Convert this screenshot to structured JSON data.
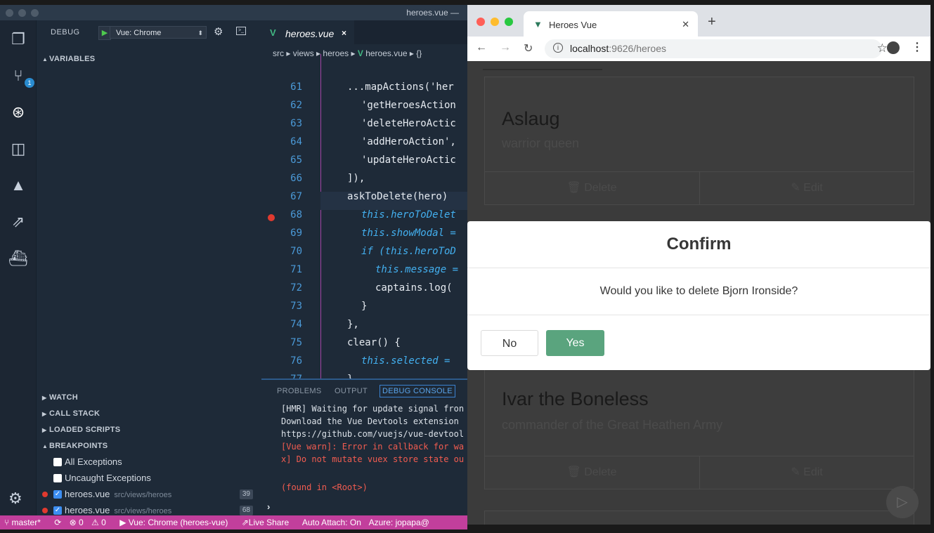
{
  "vscode": {
    "window_title": "heroes.vue —",
    "debug": {
      "label": "DEBUG",
      "config": "Vue: Chrome",
      "sections": {
        "variables": "VARIABLES",
        "watch": "WATCH",
        "call_stack": "CALL STACK",
        "loaded_scripts": "LOADED SCRIPTS",
        "breakpoints": "BREAKPOINTS"
      },
      "exceptions": [
        "All Exceptions",
        "Uncaught Exceptions"
      ],
      "breakpoints": [
        {
          "file": "heroes.vue",
          "path": "src/views/heroes",
          "line": "39"
        },
        {
          "file": "heroes.vue",
          "path": "src/views/heroes",
          "line": "68"
        }
      ]
    },
    "source_control_badge": "1",
    "editor": {
      "tab": "heroes.vue",
      "breadcrumb": [
        "src",
        "views",
        "heroes",
        "heroes.vue",
        "{}"
      ],
      "lines": [
        {
          "n": "61",
          "text": "...mapActions('her"
        },
        {
          "n": "62",
          "text": "'getHeroesAction"
        },
        {
          "n": "63",
          "text": "'deleteHeroActic"
        },
        {
          "n": "64",
          "text": "'addHeroAction',"
        },
        {
          "n": "65",
          "text": "'updateHeroActic"
        },
        {
          "n": "66",
          "text": "]),"
        },
        {
          "n": "67",
          "text": "askToDelete(hero)"
        },
        {
          "n": "68",
          "text": "this.heroToDelet"
        },
        {
          "n": "69",
          "text": "this.showModal ="
        },
        {
          "n": "70",
          "text": "if (this.heroToD"
        },
        {
          "n": "71",
          "text": "this.message ="
        },
        {
          "n": "72",
          "text": "captains.log("
        },
        {
          "n": "73",
          "text": "}"
        },
        {
          "n": "74",
          "text": "},"
        },
        {
          "n": "75",
          "text": "clear() {"
        },
        {
          "n": "76",
          "text": "this.selected ="
        },
        {
          "n": "77",
          "text": "},"
        }
      ]
    },
    "panel": {
      "tabs": [
        "PROBLEMS",
        "OUTPUT",
        "DEBUG CONSOLE"
      ],
      "output": [
        {
          "text": "[HMR] Waiting for update signal fron",
          "type": "log"
        },
        {
          "text": "Download the Vue Devtools extension",
          "type": "log"
        },
        {
          "text": "https://github.com/vuejs/vue-devtool",
          "type": "log"
        },
        {
          "text": "[Vue warn]: Error in callback for wa",
          "type": "warn"
        },
        {
          "text": "x] Do not mutate vuex store state ou",
          "type": "warn"
        },
        {
          "text": "(found in <Root>)",
          "type": "warn"
        }
      ],
      "prompt": "›"
    },
    "statusbar": {
      "branch": "master*",
      "errors": "0",
      "warnings": "0",
      "debug_target": "Vue: Chrome (heroes-vue)",
      "live_share": "Live Share",
      "auto_attach": "Auto Attach: On",
      "azure": "Azure: jopapa@"
    }
  },
  "chrome": {
    "tab_title": "Heroes Vue",
    "url_host": "localhost",
    "url_rest": ":9626/heroes",
    "cards": [
      {
        "name": "Aslaug",
        "description": "warrior queen",
        "delete": "Delete",
        "edit": "Edit"
      },
      {
        "name": "Ivar the Boneless",
        "description": "commander of the Great Heathen Army",
        "delete": "Delete",
        "edit": "Edit"
      }
    ],
    "modal": {
      "title": "Confirm",
      "message": "Would you like to delete Bjorn Ironside?",
      "no": "No",
      "yes": "Yes"
    }
  }
}
